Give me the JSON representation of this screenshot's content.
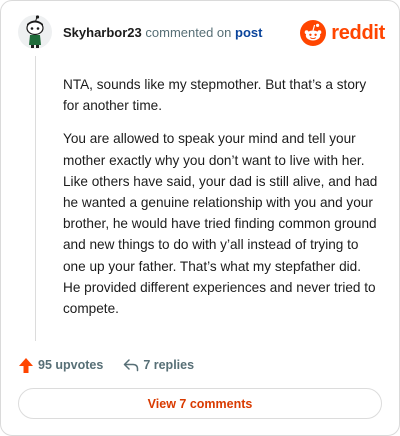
{
  "comment": {
    "username": "Skyharbor23",
    "action_text": "commented on",
    "post_link": "post",
    "paragraphs": [
      "NTA, sounds like my stepmother. But that’s a story for another time.",
      "You are allowed to speak your mind and tell your mother exactly why you don’t want to live with her. Like others have said, your dad is still alive, and had he wanted a genuine relationship with you and your brother, he would have tried finding common ground and new things to do with y’all instead of trying to one up your father. That’s what my stepfather did. He provided different experiences and never tried to compete."
    ]
  },
  "brand": {
    "wordmark": "reddit",
    "color": "#ff4500"
  },
  "actions": {
    "upvotes": "95 upvotes",
    "replies": "7 replies"
  },
  "footer": {
    "view_comments": "View 7 comments"
  },
  "icons": {
    "avatar": "snoo-avatar-icon",
    "brand": "reddit-logo-icon",
    "upvote": "upvote-arrow-icon",
    "reply": "reply-arrow-icon"
  },
  "colors": {
    "accent": "#ff4500",
    "link": "#0a449b",
    "muted": "#576f76",
    "button_text": "#d93a00"
  }
}
